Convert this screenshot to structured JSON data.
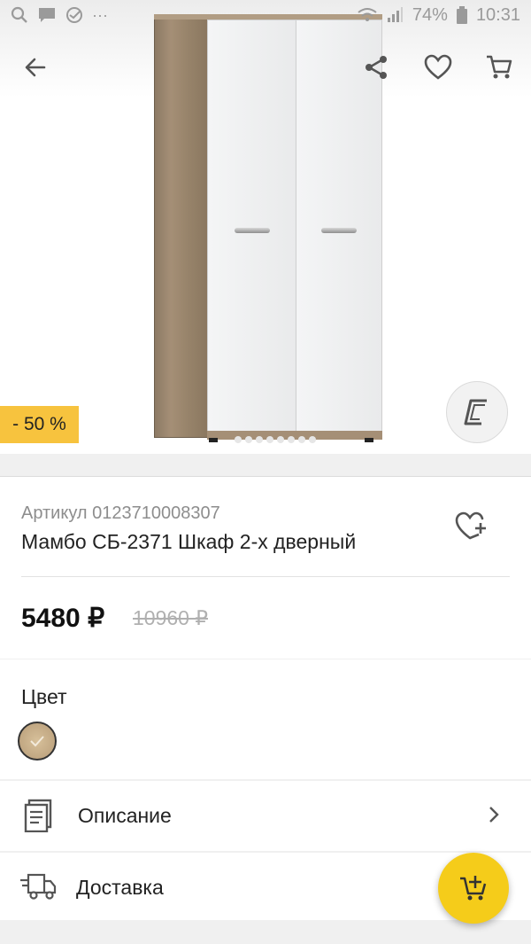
{
  "status_bar": {
    "battery": "74%",
    "time": "10:31",
    "more": "···"
  },
  "product": {
    "discount_badge": "- 50 %",
    "sku": "Артикул 0123710008307",
    "title": "Мамбо СБ-2371 Шкаф 2-х дверный",
    "price": "5480 ₽",
    "old_price": "10960 ₽"
  },
  "color_section": {
    "label": "Цвет",
    "selected_swatch": "sonoma-oak"
  },
  "rows": [
    {
      "label": "Описание",
      "icon": "document-icon"
    },
    {
      "label": "Доставка",
      "icon": "truck-icon"
    }
  ],
  "colors": {
    "accent": "#f5cc1a",
    "discount": "#f7c33e",
    "old_price": "#b0b0b0"
  }
}
